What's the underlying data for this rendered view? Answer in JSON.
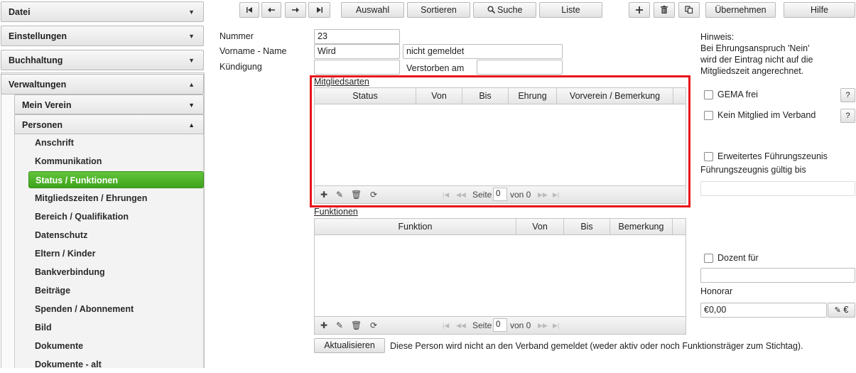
{
  "sidebar": {
    "sections": [
      {
        "label": "Datei",
        "caret": "▼"
      },
      {
        "label": "Einstellungen",
        "caret": "▼"
      },
      {
        "label": "Buchhaltung",
        "caret": "▼"
      },
      {
        "label": "Verwaltungen",
        "caret": "▲"
      }
    ],
    "subsections": [
      {
        "label": "Mein Verein",
        "caret": "▼"
      },
      {
        "label": "Personen",
        "caret": "▲"
      }
    ],
    "items": [
      {
        "label": "Anschrift"
      },
      {
        "label": "Kommunikation"
      },
      {
        "label": "Status / Funktionen"
      },
      {
        "label": "Mitgliedszeiten / Ehrungen"
      },
      {
        "label": "Bereich / Qualifikation"
      },
      {
        "label": "Datenschutz"
      },
      {
        "label": "Eltern / Kinder"
      },
      {
        "label": "Bankverbindung"
      },
      {
        "label": "Beiträge"
      },
      {
        "label": "Spenden / Abonnement"
      },
      {
        "label": "Bild"
      },
      {
        "label": "Dokumente"
      },
      {
        "label": "Dokumente - alt"
      }
    ],
    "active_item": "Status / Funktionen",
    "active_color": "#4cb428"
  },
  "toolbar": {
    "auswahl": "Auswahl",
    "sortieren": "Sortieren",
    "suche": "Suche",
    "liste": "Liste",
    "uebernehmen": "Übernehmen",
    "hilfe": "Hilfe"
  },
  "form": {
    "nummer_label": "Nummer",
    "nummer_value": "23",
    "vorname_name_label": "Vorname - Name",
    "vorname_value": "Wird",
    "name_value": "nicht gemeldet",
    "kuendigung_label": "Kündigung",
    "kuendigung_value": "",
    "verstorben_label": "Verstorben am",
    "verstorben_value": ""
  },
  "mitgliedsarten": {
    "title": "Mitgliedsarten",
    "columns": [
      "Status",
      "Von",
      "Bis",
      "Ehrung",
      "Vorverein / Bemerkung"
    ],
    "rows": [],
    "pager": {
      "seite_label": "Seite",
      "page": "0",
      "von_label": "von 0"
    }
  },
  "funktionen": {
    "title": "Funktionen",
    "columns": [
      "Funktion",
      "Von",
      "Bis",
      "Bemerkung"
    ],
    "rows": [],
    "pager": {
      "seite_label": "Seite",
      "page": "0",
      "von_label": "von 0"
    }
  },
  "footer": {
    "aktualisieren": "Aktualisieren",
    "message": "Diese Person wird nicht an den Verband gemeldet (weder aktiv oder noch Funktionsträger zum Stichtag)."
  },
  "right": {
    "hinweis_1": "Hinweis:",
    "hinweis_2": "Bei Ehrungsanspruch 'Nein'",
    "hinweis_3": "wird der Eintrag nicht auf die",
    "hinweis_4": "Mitgliedszeit angerechnet.",
    "gema_label": "GEMA frei",
    "gema_checked": false,
    "kein_mitglied_label": "Kein Mitglied im Verband",
    "kein_mitglied_checked": false,
    "q_label": "?",
    "fuehrung_label": "Erweitertes Führungszeunis",
    "fuehrung_checked": false,
    "fuehrung_gueltig_label": "Führungszeugnis gültig bis",
    "fuehrung_gueltig_value": "",
    "dozent_label": "Dozent für",
    "dozent_checked": false,
    "dozent_value": "",
    "honorar_label": "Honorar",
    "honorar_value": "€0,00",
    "euro_label": "€"
  },
  "highlight_color": "#e8141b"
}
